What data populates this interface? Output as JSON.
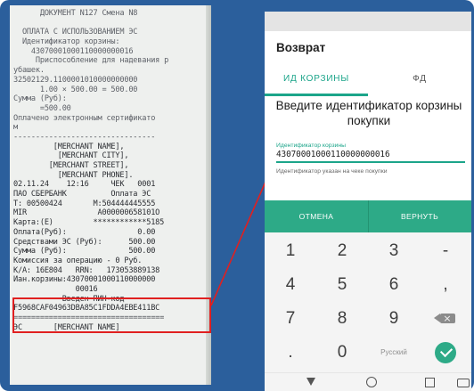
{
  "receipt": {
    "lines": [
      "      ДОКУМЕНТ N127 Смена N8",
      "",
      "  ОПЛАТА С ИСПОЛЬЗОВАНИЕМ ЭС",
      "  Идентификатор корзины:",
      "    43070001000110000000016",
      "     Приспособление для надевания р",
      "убашек.",
      "32502129.1100001010000000000",
      "      1.00 × 500.00 = 500.00",
      "Сумма (Руб):",
      "      =500.00",
      "Оплачено электронным сертификато",
      "м",
      "--------------------------------",
      "         [MERCHANT NAME],",
      "          [MERCHANT CITY],",
      "        [MERCHANT STREET],",
      "          [MERCHANT PHONE].",
      "02.11.24    12:16     ЧЕК   0001",
      "ПАО СБЕРБАНК          Оплата ЭС",
      "Т: 00500424       М:504444445555",
      "MIR                A000000658101O",
      "Карта:(Е)         ************5185",
      "Оплата(Руб):                0.00",
      "Средствами ЭС (Руб):      500.00",
      "Сумма (Руб):              500.00",
      "Комиссия за операцию - 0 Руб.",
      "К/А: 16E804   RRN:   173053889138",
      "Иан.корзины:43070001000110000000",
      "              00016",
      "           Введен ПИН-код",
      "F5968CAF04963DBA85C1FDDA4EBE411BC",
      "==================================",
      "ЭС       [MERCHANT NAME]"
    ]
  },
  "screen": {
    "title": "Возврат",
    "tabs": [
      "ИД КОРЗИНЫ",
      "ФД"
    ],
    "prompt": "Введите идентификатор корзины покупки",
    "field": {
      "label": "Идентификатор корзины",
      "value": "43070001000110000000016",
      "helper": "Идентификатор указан на чеке покупки"
    },
    "buttons": {
      "cancel": "ОТМЕНА",
      "return": "ВЕРНУТЬ"
    },
    "keypad": {
      "row1": [
        "1",
        "2",
        "3",
        "-"
      ],
      "row2": [
        "4",
        "5",
        "6",
        ","
      ],
      "row3": [
        "7",
        "8",
        "9"
      ],
      "row4": [
        ".",
        "0",
        "Русский"
      ]
    }
  },
  "colors": {
    "accent": "#2daa87",
    "frame": "#2b5f9c",
    "highlight": "#e02020"
  }
}
